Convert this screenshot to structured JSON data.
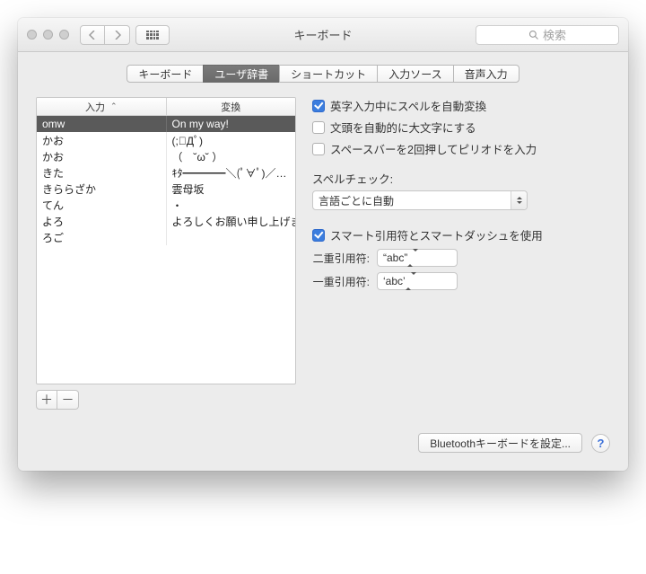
{
  "window": {
    "title": "キーボード",
    "search_placeholder": "検索"
  },
  "tabs": [
    {
      "label": "キーボード"
    },
    {
      "label": "ユーザ辞書"
    },
    {
      "label": "ショートカット"
    },
    {
      "label": "入力ソース"
    },
    {
      "label": "音声入力"
    }
  ],
  "selected_tab_index": 1,
  "table": {
    "columns": [
      "入力",
      "変換"
    ],
    "rows": [
      {
        "input": "omw",
        "conversion": "On my way!",
        "selected": true
      },
      {
        "input": "かお",
        "conversion": "(;ﾟДﾟ)"
      },
      {
        "input": "かお",
        "conversion": "（　˘ω˘ ）"
      },
      {
        "input": "きた",
        "conversion": "ｷﾀ━━━━＼(ﾟ∀ﾟ)／…"
      },
      {
        "input": "きららざか",
        "conversion": "雲母坂"
      },
      {
        "input": "てん",
        "conversion": "・"
      },
      {
        "input": "よろ",
        "conversion": "よろしくお願い申し上げま…"
      },
      {
        "input": "ろご",
        "conversion": ""
      }
    ]
  },
  "options": {
    "auto_correct": {
      "label": "英字入力中にスペルを自動変換",
      "checked": true
    },
    "auto_capitalize": {
      "label": "文頭を自動的に大文字にする",
      "checked": false
    },
    "double_space_period": {
      "label": "スペースバーを2回押してピリオドを入力",
      "checked": false
    },
    "spellcheck_label": "スペルチェック:",
    "spellcheck_value": "言語ごとに自動",
    "smart_quotes": {
      "label": "スマート引用符とスマートダッシュを使用",
      "checked": true
    },
    "double_quote_label": "二重引用符:",
    "double_quote_value": "“abc”",
    "single_quote_label": "一重引用符:",
    "single_quote_value": "‘abc’"
  },
  "footer": {
    "bluetooth_button": "Bluetoothキーボードを設定...",
    "help": "?"
  },
  "buttons": {
    "add": "＋",
    "remove": "－"
  }
}
